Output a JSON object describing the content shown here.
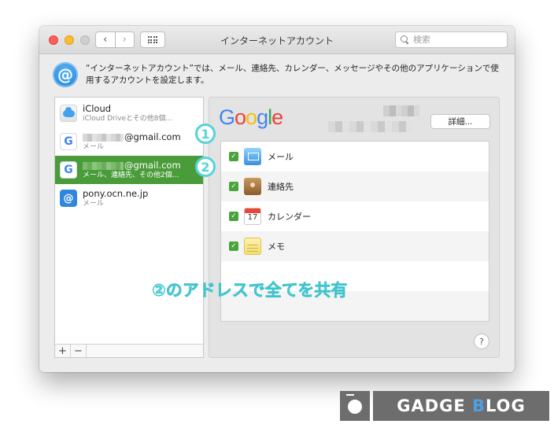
{
  "window": {
    "title": "インターネットアカウント",
    "nav_back": "‹",
    "nav_forward": "›",
    "search_placeholder": "検索"
  },
  "header": {
    "description": "“インターネットアカウント”では、メール、連絡先、カレンダー、メッセージやその他のアプリケーションで使用するアカウントを設定します。"
  },
  "accounts": [
    {
      "name": "iCloud",
      "sub": "iCloud Driveとその他8個...",
      "icon": "icloud-icon"
    },
    {
      "name": "@gmail.com",
      "sub": "メール",
      "icon": "google-icon"
    },
    {
      "name": "@gmail.com",
      "sub": "メール、連絡先、その他2個...",
      "icon": "google-icon",
      "selected": true
    },
    {
      "name": "pony.ocn.ne.jp",
      "sub": "メール",
      "icon": "at-icon"
    }
  ],
  "account_footer": {
    "add": "+",
    "remove": "−"
  },
  "detail": {
    "provider": "Google",
    "details_button": "詳細...",
    "services": [
      {
        "label": "メール",
        "checked": true,
        "icon": "mail-icon"
      },
      {
        "label": "連絡先",
        "checked": true,
        "icon": "contacts-icon"
      },
      {
        "label": "カレンダー",
        "checked": true,
        "icon": "calendar-icon",
        "day": "17"
      },
      {
        "label": "メモ",
        "checked": true,
        "icon": "notes-icon"
      }
    ],
    "help": "?"
  },
  "annotations": {
    "marker1": "1",
    "marker2": "2",
    "text": "②のアドレスで全てを共有"
  },
  "brand": {
    "pre": "GADGE ",
    "b": "B",
    "post": "LOG"
  },
  "colors": {
    "selection": "#4a9c3a",
    "annotation": "#55d4dc",
    "checkbox": "#4aa33b"
  }
}
